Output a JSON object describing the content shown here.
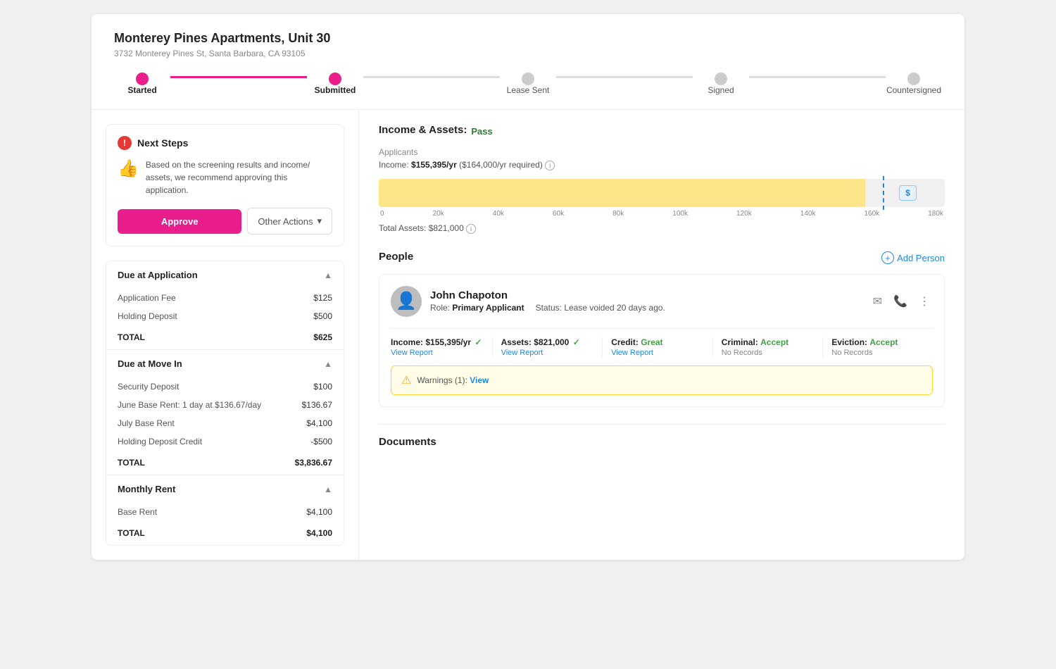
{
  "header": {
    "property_name": "Monterey Pines Apartments, Unit 30",
    "property_address": "3732 Monterey Pines St, Santa Barbara, CA 93105"
  },
  "progress": {
    "steps": [
      {
        "id": "started",
        "label": "Started",
        "state": "active",
        "bold": true
      },
      {
        "id": "submitted",
        "label": "Submitted",
        "state": "active",
        "bold": true
      },
      {
        "id": "lease-sent",
        "label": "Lease Sent",
        "state": "inactive"
      },
      {
        "id": "signed",
        "label": "Signed",
        "state": "inactive"
      },
      {
        "id": "countersigned",
        "label": "Countersigned",
        "state": "inactive"
      }
    ]
  },
  "next_steps": {
    "title": "Next Steps",
    "description": "Based on the screening results and income/ assets, we recommend approving this application.",
    "approve_label": "Approve",
    "other_actions_label": "Other Actions"
  },
  "due_at_application": {
    "title": "Due at Application",
    "items": [
      {
        "label": "Application Fee",
        "amount": "$125"
      },
      {
        "label": "Holding Deposit",
        "amount": "$500"
      }
    ],
    "total_label": "TOTAL",
    "total_amount": "$625"
  },
  "due_at_move_in": {
    "title": "Due at Move In",
    "items": [
      {
        "label": "Security Deposit",
        "amount": "$100"
      },
      {
        "label": "June Base Rent: 1 day at $136.67/day",
        "amount": "$136.67"
      },
      {
        "label": "July Base Rent",
        "amount": "$4,100"
      },
      {
        "label": "Holding Deposit Credit",
        "amount": "-$500"
      }
    ],
    "total_label": "TOTAL",
    "total_amount": "$3,836.67"
  },
  "monthly_rent": {
    "title": "Monthly Rent",
    "items": [
      {
        "label": "Base Rent",
        "amount": "$4,100"
      }
    ],
    "total_label": "TOTAL",
    "total_amount": "$4,100"
  },
  "income_assets": {
    "section_title": "Income & Assets:",
    "pass_label": "Pass",
    "applicants_label": "Applicants",
    "income_text": "Income: ",
    "income_value": "$155,395/yr",
    "income_required": "($164,000/yr required)",
    "bar_fill_percent": 86,
    "bar_marker_percent": 89,
    "axis_labels": [
      "0",
      "20k",
      "40k",
      "60k",
      "80k",
      "100k",
      "120k",
      "140k",
      "160k",
      "180k"
    ],
    "total_assets_label": "Total Assets: $821,000"
  },
  "people": {
    "section_title": "People",
    "add_person_label": "Add Person",
    "persons": [
      {
        "name": "John Chapoton",
        "role_label": "Role:",
        "role": "Primary Applicant",
        "status_label": "Status:",
        "status": "Lease voided 20 days ago.",
        "income_label": "Income:",
        "income_value": "$155,395/yr",
        "assets_label": "Assets:",
        "assets_value": "$821,000",
        "credit_label": "Credit:",
        "credit_value": "Great",
        "criminal_label": "Criminal:",
        "criminal_value": "Accept",
        "criminal_sub": "No Records",
        "eviction_label": "Eviction:",
        "eviction_value": "Accept",
        "eviction_sub": "No Records",
        "view_report_label": "View Report"
      }
    ]
  },
  "warnings": {
    "text": "Warnings (1):",
    "view_label": "View"
  },
  "documents": {
    "section_title": "Documents"
  }
}
